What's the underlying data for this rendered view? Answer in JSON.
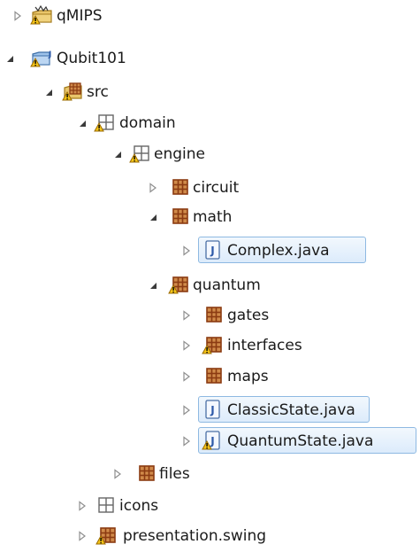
{
  "tree": {
    "items": [
      {
        "label": "qMIPS",
        "icon": "project-warning-icon",
        "state": "collapsed"
      },
      {
        "label": "Qubit101",
        "icon": "java-project-warning-icon",
        "state": "expanded"
      },
      {
        "label": "src",
        "icon": "source-folder-warning-icon",
        "state": "expanded"
      },
      {
        "label": "domain",
        "icon": "empty-package-warning-icon",
        "state": "expanded"
      },
      {
        "label": "engine",
        "icon": "empty-package-warning-icon",
        "state": "expanded"
      },
      {
        "label": "circuit",
        "icon": "package-icon",
        "state": "collapsed"
      },
      {
        "label": "math",
        "icon": "package-icon",
        "state": "expanded"
      },
      {
        "label": "Complex.java",
        "icon": "java-file-icon",
        "state": "collapsed"
      },
      {
        "label": "quantum",
        "icon": "package-warning-icon",
        "state": "expanded"
      },
      {
        "label": "gates",
        "icon": "package-icon",
        "state": "collapsed"
      },
      {
        "label": "interfaces",
        "icon": "package-warning-icon",
        "state": "collapsed"
      },
      {
        "label": "maps",
        "icon": "package-icon",
        "state": "collapsed"
      },
      {
        "label": "ClassicState.java",
        "icon": "java-file-icon",
        "state": "collapsed"
      },
      {
        "label": "QuantumState.java",
        "icon": "java-file-warning-icon",
        "state": "collapsed"
      },
      {
        "label": "files",
        "icon": "package-icon",
        "state": "collapsed"
      },
      {
        "label": "icons",
        "icon": "empty-package-icon",
        "state": "collapsed"
      },
      {
        "label": "presentation.swing",
        "icon": "package-warning-icon",
        "state": "collapsed"
      }
    ]
  },
  "colors": {
    "selection_border": "#8eb9e2",
    "package_brown": "#8b3b12",
    "warning_yellow": "#f5c518"
  }
}
